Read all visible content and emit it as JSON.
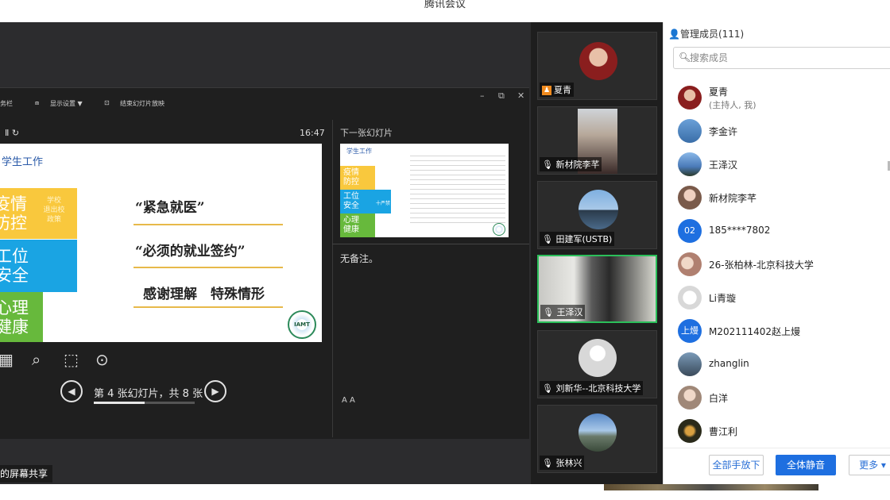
{
  "window": {
    "title": "腾讯会议"
  },
  "presenter_toolbar": {
    "item1": "务栏",
    "item2": "显示设置 ▼",
    "item3": "结束幻灯片放映",
    "minimize": "–",
    "restore": "⧉",
    "close": "✕"
  },
  "presenter": {
    "controls": "Ⅱ  ↻",
    "time": "16:47",
    "next_label": "下一张幻灯片",
    "notes": "无备注。",
    "nav_text": "第 4 张幻灯片，共 8 张",
    "slide_progress": 0.5,
    "prev_glyph": "◀",
    "next_glyph": "▶",
    "font_icons": "A  A"
  },
  "slide": {
    "header": "学生工作",
    "block1_big": "疫情\n防控",
    "block1_small": "学校\n退出校\n政策",
    "block2_big": "工位\n安全",
    "block3_big": "心理\n健康",
    "quote1": "“紧急就医”",
    "quote2": "“必须的就业签约”",
    "quote3": "感谢理解　特殊情形",
    "logo_text": "IAMT"
  },
  "next_slide": {
    "header": "学生工作",
    "b1": "疫情\n防控",
    "b2": "工位\n安全",
    "b2_small": "十严禁",
    "b3": "心理\n健康"
  },
  "share_label": "的屏幕共享",
  "videos": [
    {
      "name": "夏青",
      "icon": "host-icon"
    },
    {
      "name": "新材院李芊",
      "icon": "mic-icon"
    },
    {
      "name": "田建军(USTB)",
      "icon": "mic-muted-icon"
    },
    {
      "name": "王泽汉",
      "icon": "mic-icon"
    },
    {
      "name": "刘新华--北京科技大学",
      "icon": "mic-muted-icon"
    },
    {
      "name": "张林兴",
      "icon": "mic-muted-icon"
    }
  ],
  "panel": {
    "title": "管理成员(111)",
    "search_placeholder": "搜索成员",
    "members": [
      {
        "name": "夏青",
        "sub": "(主持人, 我)",
        "color": "#8a1e1e"
      },
      {
        "name": "李金许",
        "color": "#3a6ea8"
      },
      {
        "name": "王泽汉",
        "color": "#4a7ab8"
      },
      {
        "name": "新材院李芊",
        "color": "#7a5a4a"
      },
      {
        "name": "185****7802",
        "badge": "02",
        "color": "#1e6fe0"
      },
      {
        "name": "26-张柏林-北京科技大学",
        "color": "#b08070"
      },
      {
        "name": "Li青璇",
        "color": "#d8d8d8"
      },
      {
        "name": "M202111402赵上熳",
        "badge": "上熳",
        "color": "#1e6fe0"
      },
      {
        "name": "zhanglin",
        "color": "#3a4a5a"
      },
      {
        "name": "白洋",
        "color": "#a08878"
      },
      {
        "name": "曹江利",
        "color": "#2a2a1a"
      }
    ],
    "btn_lower": "全部手放下",
    "btn_mute": "全体静音",
    "btn_more": "更多 ▾"
  }
}
